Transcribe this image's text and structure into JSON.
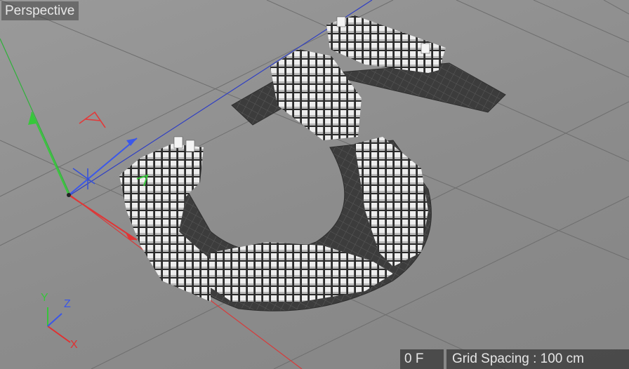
{
  "viewport": {
    "name": "Perspective",
    "frame": "0 F",
    "grid_spacing": "Grid Spacing : 100 cm"
  },
  "axis_gizmo": {
    "x_label": "X",
    "y_label": "Y",
    "z_label": "Z",
    "x_color": "#e23030",
    "y_color": "#37c43a",
    "z_color": "#3a56e8"
  },
  "colors": {
    "background": "#8e8e8e",
    "grid_line": "#6d6d6d",
    "mesh_dark": "#3d3d3d",
    "column_light": "#ececec"
  },
  "icons": [
    "light-icon",
    "camera-icon",
    "axis-gizmo-icon"
  ]
}
